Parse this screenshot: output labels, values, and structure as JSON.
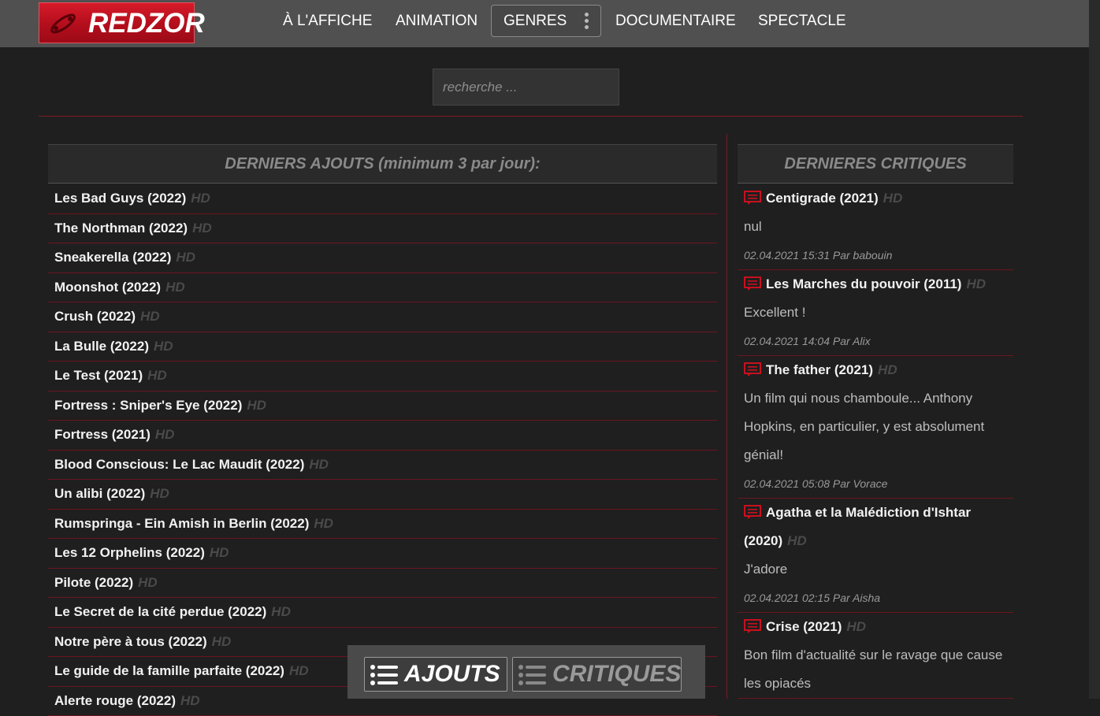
{
  "brand": {
    "name": "REDZOR"
  },
  "nav": {
    "items": [
      "À L'AFFICHE",
      "ANIMATION",
      "GENRES",
      "DOCUMENTAIRE",
      "SPECTACLE"
    ]
  },
  "search": {
    "placeholder": "recherche ..."
  },
  "left_panel": {
    "title": "DERNIERS AJOUTS (minimum 3 par jour):",
    "quality_label": "HD",
    "items": [
      "Les Bad Guys (2022)",
      "The Northman (2022)",
      "Sneakerella (2022)",
      "Moonshot (2022)",
      "Crush (2022)",
      "La Bulle (2022)",
      "Le Test (2021)",
      "Fortress : Sniper's Eye (2022)",
      "Fortress (2021)",
      "Blood Conscious: Le Lac Maudit (2022)",
      "Un alibi (2022)",
      "Rumspringa - Ein Amish in Berlin (2022)",
      "Les 12 Orphelins (2022)",
      "Pilote (2022)",
      "Le Secret de la cité perdue (2022)",
      "Notre père à tous (2022)",
      "Le guide de la famille parfaite (2022)",
      "Alerte rouge (2022)"
    ]
  },
  "right_panel": {
    "title": "DERNIERES CRITIQUES",
    "quality_label": "HD",
    "reviews": [
      {
        "title": "Centigrade (2021)",
        "text": "nul",
        "meta": "02.04.2021 15:31 Par babouin"
      },
      {
        "title": "Les Marches du pouvoir (2011)",
        "text": "Excellent !",
        "meta": "02.04.2021 14:04 Par Alix"
      },
      {
        "title": "The father (2021)",
        "text": "Un film qui nous chamboule... Anthony Hopkins, en particulier, y est absolument génial!",
        "meta": "02.04.2021 05:08 Par Vorace"
      },
      {
        "title": "Agatha et la Malédiction d'Ishtar (2020)",
        "text": "J'adore",
        "meta": "02.04.2021 02:15 Par Aisha"
      },
      {
        "title": "Crise (2021)",
        "text": "Bon film d'actualité sur le ravage que cause les opiacés",
        "meta": ""
      }
    ]
  },
  "tabs": {
    "ajouts": "AJOUTS",
    "critiques": "CRITIQUES"
  },
  "colors": {
    "accent": "#c8101e",
    "divider": "#6b1520",
    "background": "#1f1f1f",
    "topbar": "#505050"
  }
}
